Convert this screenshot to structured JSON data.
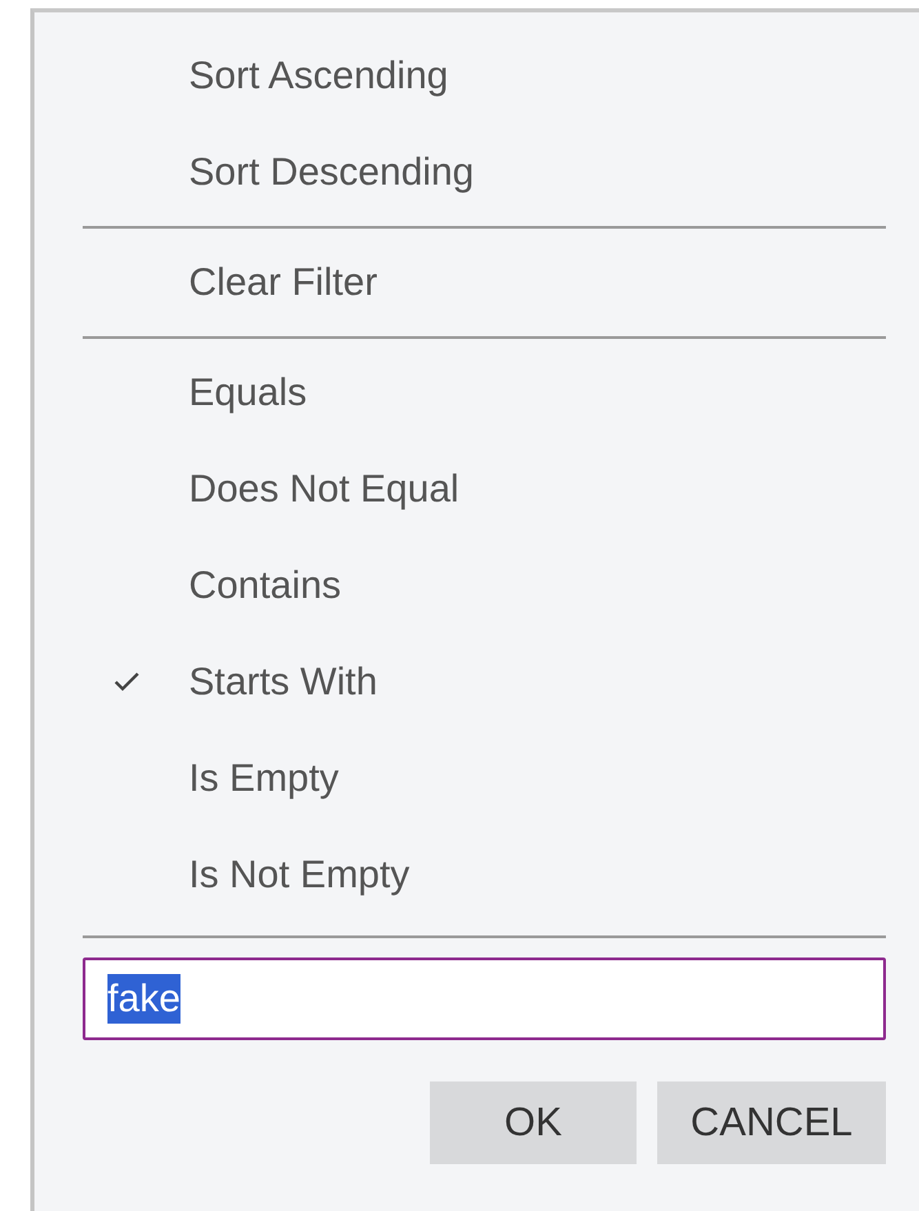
{
  "menu_groups": [
    {
      "items": [
        {
          "label": "Sort Ascending",
          "checked": false
        },
        {
          "label": "Sort Descending",
          "checked": false
        }
      ]
    },
    {
      "items": [
        {
          "label": "Clear Filter",
          "checked": false
        }
      ]
    },
    {
      "items": [
        {
          "label": "Equals",
          "checked": false
        },
        {
          "label": "Does Not Equal",
          "checked": false
        },
        {
          "label": "Contains",
          "checked": false
        },
        {
          "label": "Starts With",
          "checked": true
        },
        {
          "label": "Is Empty",
          "checked": false
        },
        {
          "label": "Is Not Empty",
          "checked": false
        }
      ]
    }
  ],
  "filter_field": {
    "value": "fake",
    "text_selected": true
  },
  "buttons": [
    "OK",
    "CANCEL"
  ]
}
